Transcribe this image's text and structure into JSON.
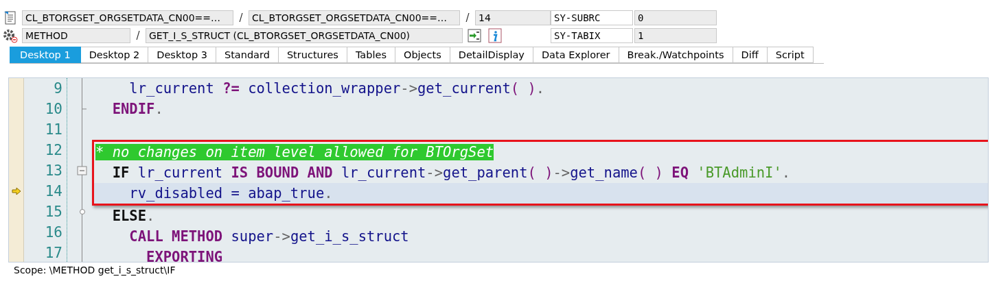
{
  "header": {
    "rows": [
      {
        "fields": [
          {
            "value": "CL_BTORGSET_ORGSETDATA_CN00==…"
          },
          {
            "value": "CL_BTORGSET_ORGSETDATA_CN00==…"
          },
          {
            "value": "14"
          }
        ],
        "var": {
          "name": "SY-SUBRC",
          "value": "0"
        }
      },
      {
        "fields": [
          {
            "value": "METHOD"
          },
          {
            "value": "GET_I_S_STRUCT (CL_BTORGSET_ORGSETDATA_CN00)"
          }
        ],
        "var": {
          "name": "SY-TABIX",
          "value": "1"
        }
      }
    ],
    "separator": "/"
  },
  "tabs": [
    {
      "label": "Desktop 1",
      "selected": true
    },
    {
      "label": "Desktop 2",
      "selected": false
    },
    {
      "label": "Desktop 3",
      "selected": false
    },
    {
      "label": "Standard",
      "selected": false
    },
    {
      "label": "Structures",
      "selected": false
    },
    {
      "label": "Tables",
      "selected": false
    },
    {
      "label": "Objects",
      "selected": false
    },
    {
      "label": "DetailDisplay",
      "selected": false
    },
    {
      "label": "Data Explorer",
      "selected": false
    },
    {
      "label": "Break./Watchpoints",
      "selected": false
    },
    {
      "label": "Diff",
      "selected": false
    },
    {
      "label": "Script",
      "selected": false
    }
  ],
  "editor": {
    "blocks": [
      {
        "kind": "plain",
        "lines": [
          {
            "number": "9",
            "current": false,
            "kind": "plain",
            "tokens": [
              {
                "kind": "id",
                "text": "    lr_current "
              },
              {
                "kind": "kw",
                "text": "?="
              },
              {
                "kind": "id",
                "text": " collection_wrapper"
              },
              {
                "kind": "op",
                "text": "->"
              },
              {
                "kind": "id",
                "text": "get_current"
              },
              {
                "kind": "paren",
                "text": "( )"
              },
              {
                "kind": "op",
                "text": "."
              }
            ]
          },
          {
            "number": "10",
            "current": false,
            "kind": "blockend",
            "tokens": [
              {
                "kind": "kw",
                "text": "  ENDIF"
              },
              {
                "kind": "op",
                "text": "."
              }
            ]
          },
          {
            "number": "11",
            "kind": "plain"
          }
        ]
      },
      {
        "kind": "framed",
        "lines": [
          {
            "number": "12",
            "current": false,
            "kind": "plain",
            "tokens": [
              {
                "kind": "comment",
                "text": "* no changes on item level allowed for BTOrgSet"
              }
            ]
          },
          {
            "number": "13",
            "current": false,
            "kind": "blockstart",
            "tokens": [
              {
                "kind": "kwb",
                "text": "  IF"
              },
              {
                "kind": "id",
                "text": " lr_current "
              },
              {
                "kind": "kw",
                "text": "IS BOUND AND"
              },
              {
                "kind": "id",
                "text": " lr_current"
              },
              {
                "kind": "op",
                "text": "->"
              },
              {
                "kind": "id",
                "text": "get_parent"
              },
              {
                "kind": "paren",
                "text": "( )"
              },
              {
                "kind": "op",
                "text": "->"
              },
              {
                "kind": "id",
                "text": "get_name"
              },
              {
                "kind": "paren",
                "text": "( ) "
              },
              {
                "kind": "kw",
                "text": "EQ"
              },
              {
                "kind": "str",
                "text": " 'BTAdminI'"
              },
              {
                "kind": "op",
                "text": "."
              }
            ]
          },
          {
            "number": "14",
            "current": true,
            "kind": "plain",
            "tokens": [
              {
                "kind": "id",
                "text": "    rv_disabled = abap_true"
              },
              {
                "kind": "op",
                "text": "."
              }
            ]
          }
        ]
      },
      {
        "kind": "plain",
        "lines": [
          {
            "number": "15",
            "current": false,
            "kind": "branch",
            "tokens": [
              {
                "kind": "kwb",
                "text": "  ELSE"
              },
              {
                "kind": "op",
                "text": "."
              }
            ]
          },
          {
            "number": "16",
            "current": false,
            "kind": "plain",
            "tokens": [
              {
                "kind": "kw",
                "text": "    CALL METHOD"
              },
              {
                "kind": "id",
                "text": " super"
              },
              {
                "kind": "op",
                "text": "->"
              },
              {
                "kind": "id",
                "text": "get_i_s_struct"
              }
            ]
          },
          {
            "number": "17",
            "current": false,
            "kind": "plain",
            "tokens": [
              {
                "kind": "kw",
                "text": "      EXPORTING"
              }
            ]
          }
        ]
      }
    ]
  },
  "status_bar": {
    "text": "Scope: \\METHOD get_i_s_struct\\IF"
  }
}
